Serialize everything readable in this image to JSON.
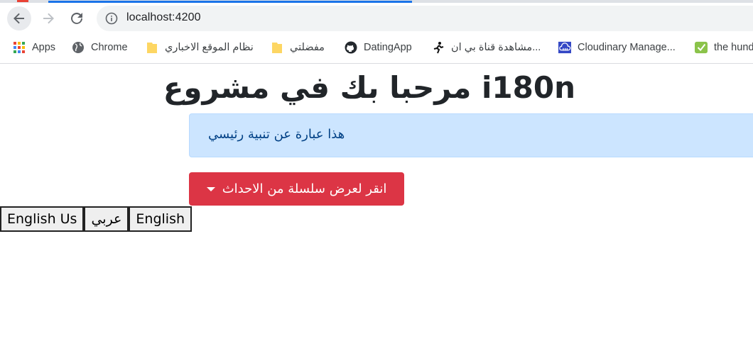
{
  "browser": {
    "url": "localhost:4200",
    "bookmarks": [
      {
        "label": "Apps",
        "icon": "apps-grid-icon"
      },
      {
        "label": "Chrome",
        "icon": "globe-icon"
      },
      {
        "label": "نظام الموقع الاخباري",
        "icon": "folder-icon"
      },
      {
        "label": "مفضلتي",
        "icon": "folder-icon"
      },
      {
        "label": "DatingApp",
        "icon": "github-icon"
      },
      {
        "label": "مشاهدة قناة بي ان...",
        "icon": "runner-icon"
      },
      {
        "label": "Cloudinary Manage...",
        "icon": "cloudinary-icon"
      },
      {
        "label": "the hund",
        "icon": "check-icon"
      }
    ]
  },
  "page": {
    "title": "i180n مرحبا بك في مشروع",
    "alert_text": "هذا عبارة عن تنبية رئيسي",
    "dropdown_label": "انقر لعرض سلسلة من الاحداث",
    "languages": [
      "English Us",
      "عربي",
      "English"
    ]
  },
  "colors": {
    "alert_bg": "#cce5ff",
    "alert_text": "#004085",
    "danger": "#dc3545",
    "accent": "#1a73e8"
  }
}
